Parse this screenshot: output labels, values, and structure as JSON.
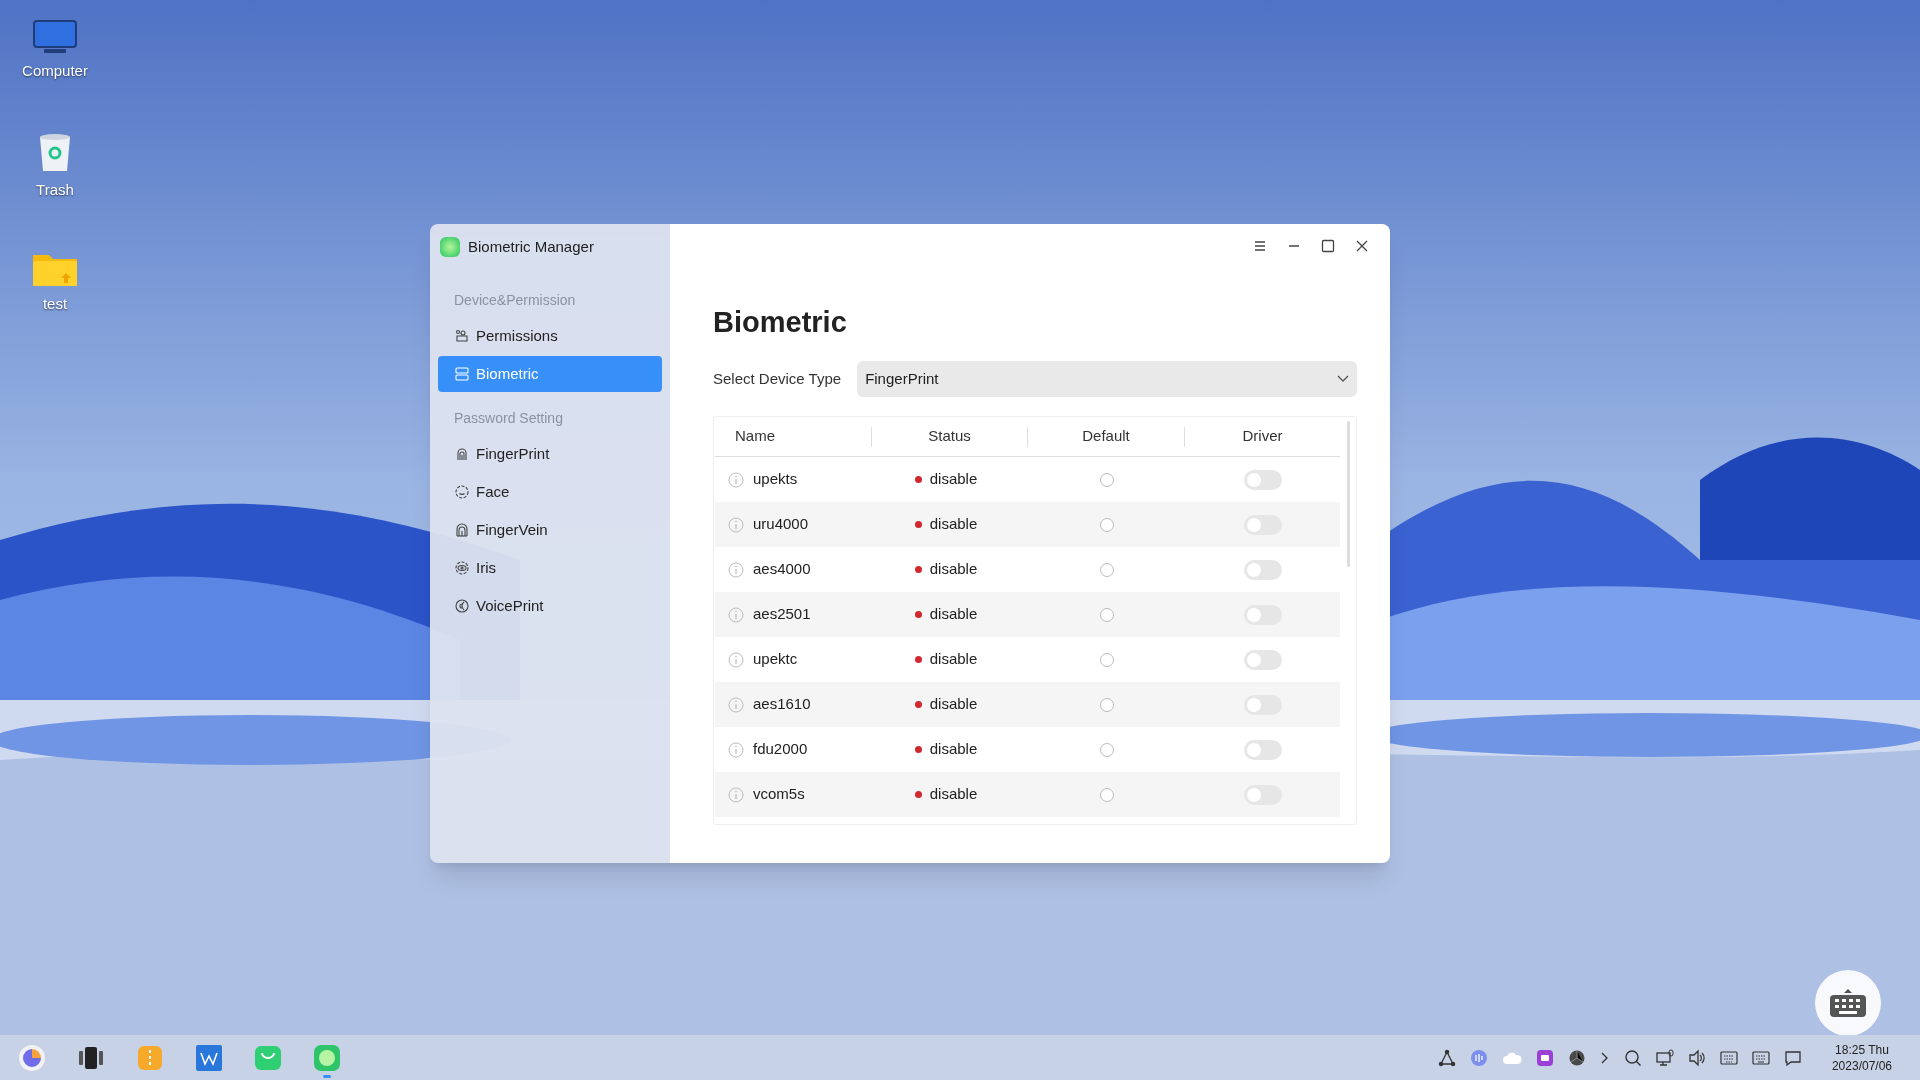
{
  "desktop_icons": [
    {
      "label": "Computer",
      "kind": "computer"
    },
    {
      "label": "Trash",
      "kind": "trash"
    },
    {
      "label": "test",
      "kind": "folder"
    }
  ],
  "window": {
    "title": "Biometric Manager"
  },
  "sidebar": {
    "groups": [
      {
        "heading": "Device&Permission",
        "items": [
          {
            "label": "Permissions",
            "selected": false
          },
          {
            "label": "Biometric",
            "selected": true
          }
        ]
      },
      {
        "heading": "Password Setting",
        "items": [
          {
            "label": "FingerPrint",
            "selected": false
          },
          {
            "label": "Face",
            "selected": false
          },
          {
            "label": "FingerVein",
            "selected": false
          },
          {
            "label": "Iris",
            "selected": false
          },
          {
            "label": "VoicePrint",
            "selected": false
          }
        ]
      }
    ]
  },
  "page_title": "Biometric",
  "device_type": {
    "label": "Select Device Type",
    "value": "FingerPrint"
  },
  "table": {
    "columns": [
      "Name",
      "Status",
      "Default",
      "Driver"
    ],
    "rows": [
      {
        "name": "upekts",
        "status": "disable",
        "color": "#d0282e",
        "default": false,
        "driver_on": false
      },
      {
        "name": "uru4000",
        "status": "disable",
        "color": "#d0282e",
        "default": false,
        "driver_on": false
      },
      {
        "name": "aes4000",
        "status": "disable",
        "color": "#d0282e",
        "default": false,
        "driver_on": false
      },
      {
        "name": "aes2501",
        "status": "disable",
        "color": "#d0282e",
        "default": false,
        "driver_on": false
      },
      {
        "name": "upektc",
        "status": "disable",
        "color": "#d0282e",
        "default": false,
        "driver_on": false
      },
      {
        "name": "aes1610",
        "status": "disable",
        "color": "#d0282e",
        "default": false,
        "driver_on": false
      },
      {
        "name": "fdu2000",
        "status": "disable",
        "color": "#d0282e",
        "default": false,
        "driver_on": false
      },
      {
        "name": "vcom5s",
        "status": "disable",
        "color": "#d0282e",
        "default": false,
        "driver_on": false
      }
    ]
  },
  "taskbar": {
    "apps": [
      {
        "kind": "start",
        "active": false
      },
      {
        "kind": "multitask",
        "active": false
      },
      {
        "kind": "archive",
        "active": false
      },
      {
        "kind": "office",
        "active": false
      },
      {
        "kind": "store",
        "active": false
      },
      {
        "kind": "biometric",
        "active": true
      }
    ],
    "time": "18:25 Thu",
    "date": "2023/07/06"
  }
}
